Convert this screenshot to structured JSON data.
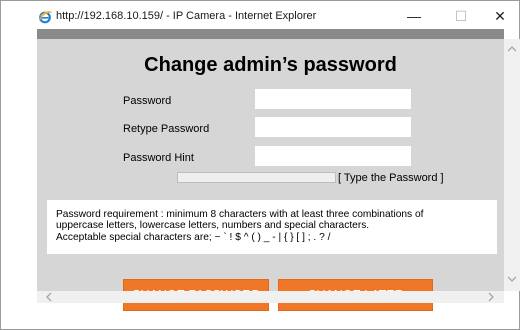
{
  "window": {
    "title": "http://192.168.10.159/ - IP Camera - Internet Explorer",
    "minimize_glyph": "—",
    "maximize_glyph": "☐",
    "close_glyph": "✕"
  },
  "page": {
    "heading": "Change admin’s password",
    "fields": [
      {
        "label": "Password",
        "value": ""
      },
      {
        "label": "Retype Password",
        "value": ""
      },
      {
        "label": "Password Hint",
        "value": ""
      }
    ],
    "strength": {
      "level": 0,
      "text": "[ Type the Password ]"
    },
    "requirements": [
      "Password requirement : minimum 8 characters with at least three combinations of",
      "uppercase letters, lowercase letters, numbers and special characters.",
      "Acceptable special characters are; ~ ` ! $ ^ ( ) _ - | { } [ ] ; . ? /"
    ],
    "buttons": {
      "change": "CHANGE PASSWORD",
      "later": "CHANGE LATER"
    }
  },
  "colors": {
    "accent": "#f07726",
    "panel": "#d6d6d6",
    "strip": "#8a8a8a"
  },
  "icons": {
    "browser": "internet-explorer-icon",
    "scroll_up": "chevron-up-icon",
    "scroll_down": "chevron-down-icon",
    "scroll_left": "chevron-left-icon",
    "scroll_right": "chevron-right-icon"
  }
}
